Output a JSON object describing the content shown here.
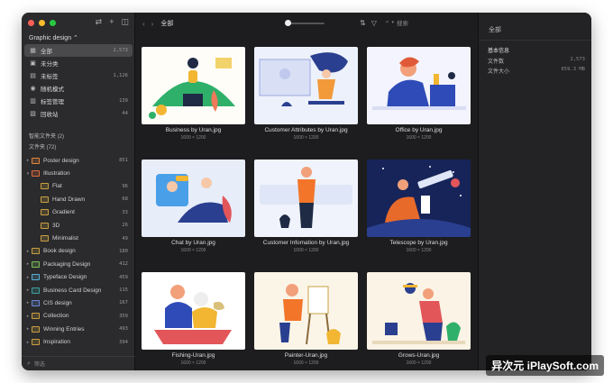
{
  "sidebar": {
    "library": "Graphic design ⌃",
    "nav": [
      {
        "icon": "grid-icon",
        "glyph": "▦",
        "label": "全部",
        "count": "2,573"
      },
      {
        "icon": "unsorted-icon",
        "glyph": "▣",
        "label": "未分类",
        "count": ""
      },
      {
        "icon": "untagged-icon",
        "glyph": "▤",
        "label": "未标签",
        "count": "1,126"
      },
      {
        "icon": "random-icon",
        "glyph": "◉",
        "label": "随机模式",
        "count": ""
      },
      {
        "icon": "tag-manager-icon",
        "glyph": "▥",
        "label": "标签管理",
        "count": "139"
      },
      {
        "icon": "trash-icon",
        "glyph": "▧",
        "label": "回收站",
        "count": "44"
      }
    ],
    "smart_folders": "智能文件夹 (2)",
    "folders_header": "文件夹 (72)",
    "folders": [
      {
        "arrow": "▸",
        "label": "Poster design",
        "count": "851",
        "color": "#e0863c",
        "child": false
      },
      {
        "arrow": "▾",
        "label": "Illustration",
        "count": "",
        "color": "#e06a3c",
        "child": false
      },
      {
        "arrow": "",
        "label": "Flat",
        "count": "96",
        "color": "#c9a040",
        "child": true
      },
      {
        "arrow": "",
        "label": "Hand Drawn",
        "count": "68",
        "color": "#c9a040",
        "child": true
      },
      {
        "arrow": "",
        "label": "Gradient",
        "count": "33",
        "color": "#c9a040",
        "child": true
      },
      {
        "arrow": "",
        "label": "3D",
        "count": "26",
        "color": "#c9a040",
        "child": true
      },
      {
        "arrow": "",
        "label": "Minimalist",
        "count": "49",
        "color": "#c9a040",
        "child": true
      },
      {
        "arrow": "▸",
        "label": "Book design",
        "count": "180",
        "color": "#c9a040",
        "child": false
      },
      {
        "arrow": "▸",
        "label": "Packaging Design",
        "count": "412",
        "color": "#7bbf5a",
        "child": false
      },
      {
        "arrow": "▸",
        "label": "Typeface Design",
        "count": "459",
        "color": "#59b0d8",
        "child": false
      },
      {
        "arrow": "▸",
        "label": "Business Card Design",
        "count": "115",
        "color": "#3aa0a0",
        "child": false
      },
      {
        "arrow": "▸",
        "label": "CIS design",
        "count": "167",
        "color": "#6a8ad8",
        "child": false
      },
      {
        "arrow": "▸",
        "label": "Collection",
        "count": "359",
        "color": "#c9a040",
        "child": false
      },
      {
        "arrow": "▸",
        "label": "Winning Entries",
        "count": "493",
        "color": "#c9a040",
        "child": false
      },
      {
        "arrow": "▸",
        "label": "Inspiration",
        "count": "394",
        "color": "#c9a040",
        "child": false
      }
    ],
    "filter_label": "筛选"
  },
  "toolbar": {
    "title": "全部",
    "search_placeholder": "搜索"
  },
  "grid": {
    "items": [
      {
        "name": "Business by Uran.jpg",
        "dim": "1600 × 1200"
      },
      {
        "name": "Customer Attributes by Uran.jpg",
        "dim": "1600 × 1200"
      },
      {
        "name": "Office by Uran.jpg",
        "dim": "1600 × 1200"
      },
      {
        "name": "Chat by Uran.jpg",
        "dim": "1600 × 1200"
      },
      {
        "name": "Customer Infomation by Uran.jpg",
        "dim": "1600 × 1200"
      },
      {
        "name": "Telescope by Uran.jpg",
        "dim": "1600 × 1200"
      },
      {
        "name": "Fishing-Uran.jpg",
        "dim": "1600 × 1200"
      },
      {
        "name": "Painter-Uran.jpg",
        "dim": "1600 × 1200"
      },
      {
        "name": "Grows-Uran.jpg",
        "dim": "1600 × 1200"
      }
    ]
  },
  "panel": {
    "tab": "全部",
    "section": "基本信息",
    "rows": [
      {
        "k": "文件数",
        "v": "2,573"
      },
      {
        "k": "文件大小",
        "v": "659.3 MB"
      }
    ]
  },
  "watermark": "异次元 iPlaySoft.com"
}
